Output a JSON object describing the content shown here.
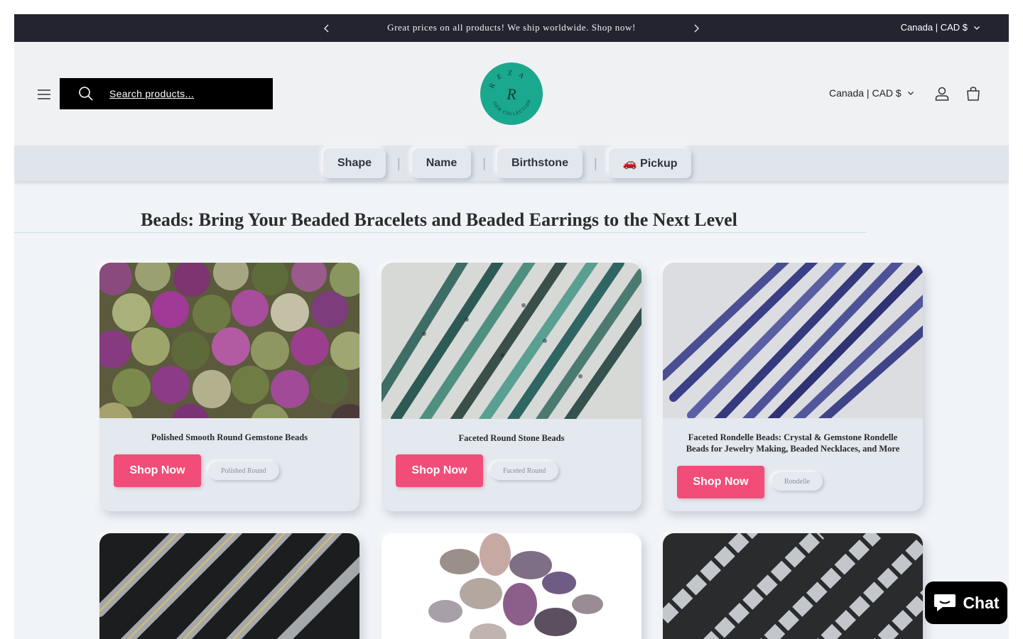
{
  "announcement": {
    "message": "Great prices on all products! We ship worldwide. Shop now!",
    "locale": "Canada | CAD $"
  },
  "header": {
    "search_placeholder": "Search products...",
    "locale": "Canada | CAD $",
    "logo_text": "REZA",
    "logo_sub": "GEM COLLECTION",
    "logo_mark": "R"
  },
  "nav": {
    "items": [
      {
        "label": "Shape"
      },
      {
        "label": "Name"
      },
      {
        "label": "Birthstone"
      },
      {
        "label": "🚗 Pickup"
      }
    ],
    "separator": "|"
  },
  "page": {
    "heading": "Beads: Bring Your Beaded Bracelets and Beaded Earrings to the Next Level"
  },
  "cards": [
    {
      "title": "Polished Smooth Round Gemstone Beads",
      "button": "Shop Now",
      "tag": "Polished Round"
    },
    {
      "title": "Faceted Round Stone Beads",
      "button": "Shop Now",
      "tag": "Faceted Round"
    },
    {
      "title": "Faceted Rondelle Beads: Crystal & Gemstone Rondelle Beads for Jewelry Making, Beaded Necklaces, and More",
      "button": "Shop Now",
      "tag": "Rondelle"
    }
  ],
  "chat": {
    "label": "Chat"
  },
  "colors": {
    "announcement_bg": "#23242f",
    "accent_button": "#f14d78",
    "logo_teal": "#1aa88f",
    "search_bg": "#000000"
  }
}
